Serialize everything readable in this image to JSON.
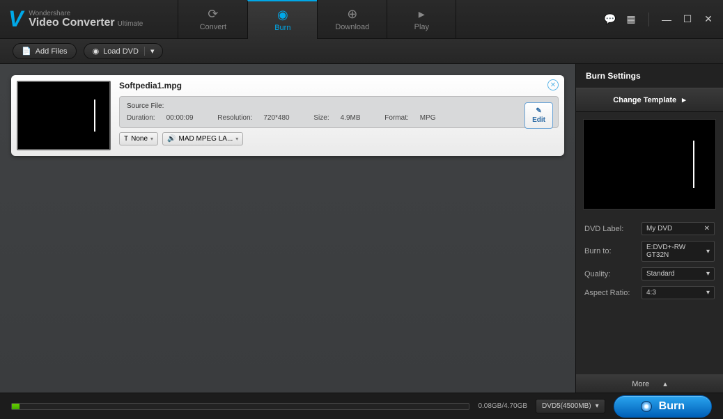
{
  "brand": {
    "company": "Wondershare",
    "product": "Video Converter",
    "edition": "Ultimate"
  },
  "tabs": {
    "convert": "Convert",
    "burn": "Burn",
    "download": "Download",
    "play": "Play"
  },
  "toolbar": {
    "add_files": "Add Files",
    "load_dvd": "Load DVD"
  },
  "media": {
    "filename": "Softpedia1.mpg",
    "source_label": "Source File:",
    "duration_label": "Duration:",
    "duration": "00:00:09",
    "resolution_label": "Resolution:",
    "resolution": "720*480",
    "size_label": "Size:",
    "size": "4.9MB",
    "format_label": "Format:",
    "format": "MPG",
    "subtitle_sel": "None",
    "audio_sel": "MAD MPEG LA...",
    "edit_label": "Edit"
  },
  "sidebar": {
    "title": "Burn Settings",
    "change_template": "Change Template",
    "dvd_label_label": "DVD Label:",
    "dvd_label": "My DVD",
    "burn_to_label": "Burn to:",
    "burn_to": "E:DVD+-RW GT32N",
    "quality_label": "Quality:",
    "quality": "Standard",
    "aspect_label": "Aspect Ratio:",
    "aspect": "4:3",
    "more": "More"
  },
  "footer": {
    "used_total": "0.08GB/4.70GB",
    "disc_sel": "DVD5(4500MB)",
    "burn_btn": "Burn"
  }
}
